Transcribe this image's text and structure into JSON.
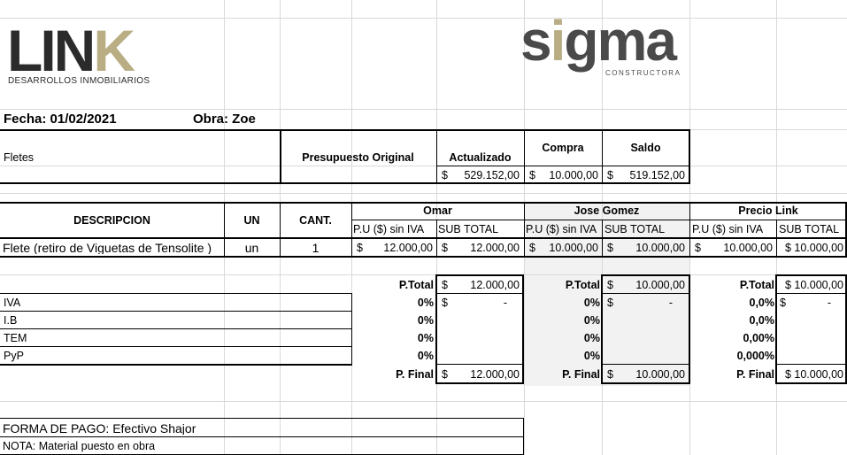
{
  "logos": {
    "link_main": "LIN",
    "link_k": "K",
    "link_sub": "DESARROLLOS INMOBILIARIOS",
    "sigma_a": "s",
    "sigma_i": "i",
    "sigma_b": "gma",
    "sigma_sub": "CONSTRUCTORA"
  },
  "header": {
    "fecha": "Fecha: 01/02/2021",
    "obra": "Obra: Zoe"
  },
  "budget": {
    "concept": "Fletes",
    "presupuesto_original_label": "Presupuesto Original",
    "actualizado_label": "Actualizado",
    "compra_label": "Compra",
    "saldo_label": "Saldo",
    "actualizado_value": "529.152,00",
    "compra_value": "10.000,00",
    "saldo_value": "519.152,00",
    "currency": "$"
  },
  "table": {
    "descripcion_label": "DESCRIPCION",
    "un_label": "UN",
    "cant_label": "CANT.",
    "providers": [
      "Omar",
      "Jose Gomez",
      "Precio Link"
    ],
    "pu_label": "P.U ($) sin IVA",
    "subtotal_label": "SUB TOTAL",
    "row": {
      "descripcion": "Flete (retiro de Viguetas de Tensolite )",
      "un": "un",
      "cant": "1",
      "omar_pu": "12.000,00",
      "omar_sub": "12.000,00",
      "jose_pu": "10.000,00",
      "jose_sub": "10.000,00",
      "link_pu": "10.000,00",
      "link_sub": "$ 10.000,00"
    }
  },
  "totals": {
    "ptotal_label": "P.Total",
    "pfinal_label": "P. Final",
    "dash": "-",
    "omar_ptotal": "12.000,00",
    "jose_ptotal": "10.000,00",
    "link_ptotal": "$ 10.000,00",
    "omar_pfinal": "12.000,00",
    "jose_pfinal": "10.000,00",
    "link_pfinal": "$ 10.000,00",
    "rows": [
      {
        "label": "IVA",
        "omar": "0%",
        "jose": "0%",
        "link": "0,0%"
      },
      {
        "label": "I.B",
        "omar": "0%",
        "jose": "0%",
        "link": "0,0%"
      },
      {
        "label": "TEM",
        "omar": "0%",
        "jose": "0%",
        "link": "0,00%"
      },
      {
        "label": "PyP",
        "omar": "0%",
        "jose": "0%",
        "link": "0,000%"
      }
    ]
  },
  "footer": {
    "forma_pago": "FORMA DE PAGO: Efectivo Shajor",
    "nota": "NOTA: Material puesto en obra"
  }
}
